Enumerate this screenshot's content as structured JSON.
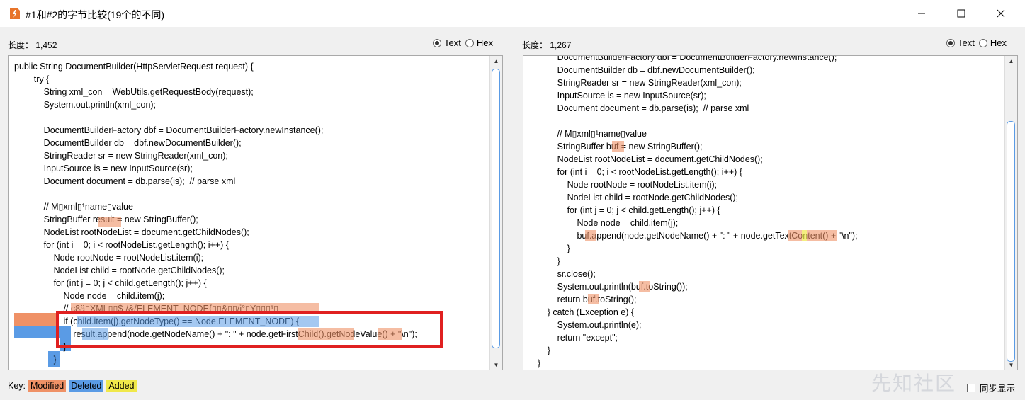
{
  "window": {
    "title": "#1和#2的字节比较(19个的不同)"
  },
  "left_pane": {
    "length_label": "长度：  1,452",
    "radio_text": "Text",
    "radio_hex": "Hex",
    "lines": [
      "public String DocumentBuilder(HttpServletRequest request) {",
      "        try {",
      "            String xml_con = WebUtils.getRequestBody(request);",
      "            System.out.println(xml_con);",
      "",
      "            DocumentBuilderFactory dbf = DocumentBuilderFactory.newInstance();",
      "            DocumentBuilder db = dbf.newDocumentBuilder();",
      "            StringReader sr = new StringReader(xml_con);",
      "            InputSource is = new InputSource(sr);",
      "            Document document = db.parse(is);  // parse xml",
      "",
      "            // M▯xml▯¹name▯value",
      "            StringBuffer result = new StringBuffer();",
      "            NodeList rootNodeList = document.getChildNodes();",
      "            for (int i = 0; i < rootNodeList.getLength(); i++) {",
      "                Node rootNode = rootNodeList.item(i);",
      "                NodeList child = rootNode.getChildNodes();",
      "                for (int j = 0; j < child.getLength(); j++) {",
      "                    Node node = child.item(j);",
      "                    // c8ä▯XML▯▯$-/&/ELEMENT_NODE{▯▯&▯▯/i°▯Y▯▯▯¹▯",
      "                    if (child.item(j).getNodeType() == Node.ELEMENT_NODE) {",
      "                        result.append(node.getNodeName() + \": \" + node.getFirstChild().getNodeValue() + \"\\n\");",
      "                    }",
      "                }"
    ]
  },
  "right_pane": {
    "length_label": "长度：  1,267",
    "radio_text": "Text",
    "radio_hex": "Hex",
    "lines": [
      "            DocumentBuilderFactory dbf = DocumentBuilderFactory.newInstance();",
      "            DocumentBuilder db = dbf.newDocumentBuilder();",
      "            StringReader sr = new StringReader(xml_con);",
      "            InputSource is = new InputSource(sr);",
      "            Document document = db.parse(is);  // parse xml",
      "",
      "            // M▯xml▯¹name▯value",
      "            StringBuffer buf = new StringBuffer();",
      "            NodeList rootNodeList = document.getChildNodes();",
      "            for (int i = 0; i < rootNodeList.getLength(); i++) {",
      "                Node rootNode = rootNodeList.item(i);",
      "                NodeList child = rootNode.getChildNodes();",
      "                for (int j = 0; j < child.getLength(); j++) {",
      "                    Node node = child.item(j);",
      "                    buf.append(node.getNodeName() + \": \" + node.getTextContent() + \"\\n\");",
      "                }",
      "            }",
      "            sr.close();",
      "            System.out.println(buf.toString());",
      "            return buf.toString();",
      "        } catch (Exception e) {",
      "            System.out.println(e);",
      "            return \"except\";",
      "        }",
      "    }"
    ]
  },
  "key": {
    "label": "Key:",
    "modified": "Modified",
    "deleted": "Deleted",
    "added": "Added"
  },
  "sync_label": "同步显示",
  "watermark": "先知社区",
  "colors": {
    "modified": "#ef9166",
    "deleted": "#5a9be5",
    "added": "#f0e84a",
    "annotation": "#e02020"
  }
}
